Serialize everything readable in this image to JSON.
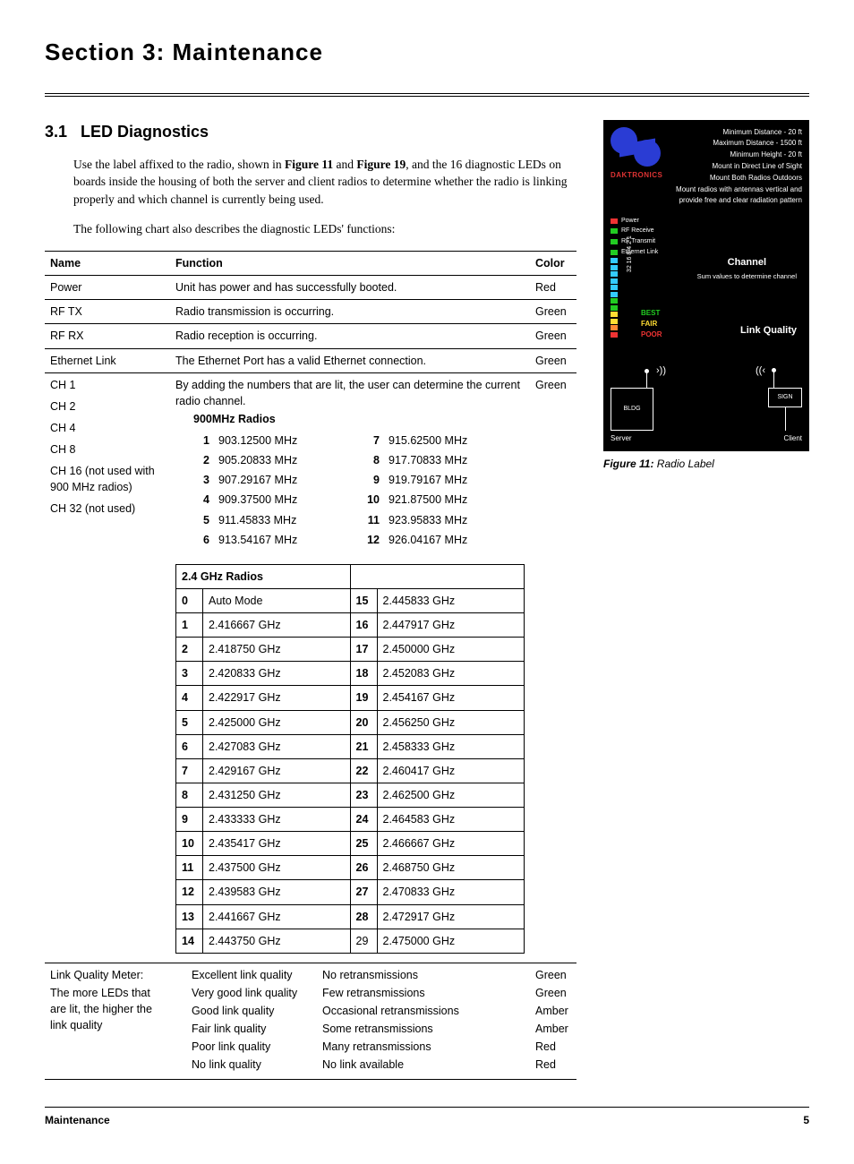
{
  "section_title": "Section 3:   Maintenance",
  "sub_num": "3.1",
  "sub_title": "LED Diagnostics",
  "para1_a": "Use the label affixed to the radio, shown in ",
  "para1_fig11": "Figure 11",
  "para1_b": " and ",
  "para1_fig19": "Figure 19",
  "para1_c": ", and the 16 diagnostic LEDs on boards inside the housing of both the server and client radios to determine whether the radio is linking properly and which channel is currently being used.",
  "para2": "The following chart also describes the diagnostic LEDs' functions:",
  "th_name": "Name",
  "th_function": "Function",
  "th_color": "Color",
  "rows_simple": [
    {
      "name": "Power",
      "fn": "Unit has power and has successfully booted.",
      "color": "Red"
    },
    {
      "name": "RF TX",
      "fn": "Radio transmission is occurring.",
      "color": "Green"
    },
    {
      "name": "RF RX",
      "fn": "Radio reception is occurring.",
      "color": "Green"
    },
    {
      "name": "Ethernet Link",
      "fn": "The Ethernet Port has a valid Ethernet connection.",
      "color": "Green"
    }
  ],
  "ch_names": [
    "CH 1",
    "CH 2",
    "CH 4",
    "CH 8",
    "CH 16 (not used with 900 MHz radios)",
    "CH 32 (not used)"
  ],
  "ch_fn_intro": "By adding the numbers that are lit, the user can determine the current radio channel.",
  "ch_color": "Green",
  "head_900": "900MHz Radios",
  "freq_900_a": [
    {
      "n": "1",
      "v": "903.12500 MHz"
    },
    {
      "n": "2",
      "v": "905.20833 MHz"
    },
    {
      "n": "3",
      "v": "907.29167 MHz"
    },
    {
      "n": "4",
      "v": "909.37500 MHz"
    },
    {
      "n": "5",
      "v": "911.45833 MHz"
    },
    {
      "n": "6",
      "v": "913.54167 MHz"
    }
  ],
  "freq_900_b": [
    {
      "n": "7",
      "v": "915.62500 MHz"
    },
    {
      "n": "8",
      "v": "917.70833 MHz"
    },
    {
      "n": "9",
      "v": "919.79167 MHz"
    },
    {
      "n": "10",
      "v": "921.87500 MHz"
    },
    {
      "n": "11",
      "v": "923.95833 MHz"
    },
    {
      "n": "12",
      "v": "926.04167 MHz"
    }
  ],
  "head_24": "2.4 GHz Radios",
  "freq_24": [
    {
      "n": "0",
      "v": "Auto Mode",
      "n2": "15",
      "v2": "2.445833 GHz"
    },
    {
      "n": "1",
      "v": "2.416667 GHz",
      "n2": "16",
      "v2": "2.447917 GHz"
    },
    {
      "n": "2",
      "v": "2.418750 GHz",
      "n2": "17",
      "v2": "2.450000 GHz"
    },
    {
      "n": "3",
      "v": "2.420833 GHz",
      "n2": "18",
      "v2": "2.452083 GHz"
    },
    {
      "n": "4",
      "v": "2.422917 GHz",
      "n2": "19",
      "v2": "2.454167 GHz"
    },
    {
      "n": "5",
      "v": "2.425000 GHz",
      "n2": "20",
      "v2": "2.456250 GHz"
    },
    {
      "n": "6",
      "v": "2.427083 GHz",
      "n2": "21",
      "v2": "2.458333 GHz"
    },
    {
      "n": "7",
      "v": "2.429167 GHz",
      "n2": "22",
      "v2": "2.460417 GHz"
    },
    {
      "n": "8",
      "v": "2.431250 GHz",
      "n2": "23",
      "v2": "2.462500 GHz"
    },
    {
      "n": "9",
      "v": "2.433333 GHz",
      "n2": "24",
      "v2": "2.464583 GHz"
    },
    {
      "n": "10",
      "v": "2.435417 GHz",
      "n2": "25",
      "v2": "2.466667 GHz"
    },
    {
      "n": "11",
      "v": "2.437500 GHz",
      "n2": "26",
      "v2": "2.468750 GHz"
    },
    {
      "n": "12",
      "v": "2.439583 GHz",
      "n2": "27",
      "v2": "2.470833 GHz"
    },
    {
      "n": "13",
      "v": "2.441667 GHz",
      "n2": "28",
      "v2": "2.472917 GHz"
    },
    {
      "n": "14",
      "v": "2.443750 GHz",
      "n2": "29",
      "v2": "2.475000 GHz",
      "n2plain": true
    }
  ],
  "lqm_name1": "Link Quality Meter:",
  "lqm_name2": "The more LEDs that are lit, the higher the link quality",
  "lqm_levels": [
    {
      "q": "Excellent link quality",
      "r": "No retransmissions",
      "c": "Green"
    },
    {
      "q": "Very good link quality",
      "r": "Few retransmissions",
      "c": "Green"
    },
    {
      "q": "Good link quality",
      "r": "Occasional retransmissions",
      "c": "Amber"
    },
    {
      "q": "Fair link quality",
      "r": "Some retransmissions",
      "c": "Amber"
    },
    {
      "q": "Poor link quality",
      "r": "Many retransmissions",
      "c": "Red"
    },
    {
      "q": "No link quality",
      "r": "No link available",
      "c": "Red"
    }
  ],
  "footer_left": "Maintenance",
  "footer_right": "5",
  "fig_caption_b": "Figure 11:",
  "fig_caption_i": " Radio Label",
  "label": {
    "specs": [
      "Minimum Distance - 20 ft",
      "Maximum Distance - 1500 ft",
      "Minimum Height - 20 ft",
      "Mount in Direct Line of Sight",
      "Mount Both Radios Outdoors",
      "Mount radios with antennas vertical and",
      "provide free and clear radiation pattern"
    ],
    "brand": "DAKTRONICS",
    "leds": [
      {
        "t": "Power",
        "c": "red"
      },
      {
        "t": "RF Receive",
        "c": "grn"
      },
      {
        "t": "RF Transmit",
        "c": "grn"
      },
      {
        "t": "Ethernet Link",
        "c": "grn"
      },
      {
        "t": "",
        "c": "cyn"
      },
      {
        "t": "",
        "c": "cyn"
      },
      {
        "t": "",
        "c": "cyn"
      },
      {
        "t": "",
        "c": "cyn"
      },
      {
        "t": "",
        "c": "cyn"
      },
      {
        "t": "",
        "c": "cyn"
      },
      {
        "t": "",
        "c": "grn"
      },
      {
        "t": "",
        "c": "grn"
      },
      {
        "t": "",
        "c": "yel"
      },
      {
        "t": "",
        "c": "yel"
      },
      {
        "t": "",
        "c": "org"
      },
      {
        "t": "",
        "c": "red"
      }
    ],
    "nums": "32 16 8  4  2  1",
    "channel_hd": "Channel",
    "channel_sub": "Sum values to determine channel",
    "lq": "Link Quality",
    "bfp": {
      "best": "BEST",
      "fair": "FAIR",
      "poor": "POOR"
    },
    "bldg": "BLDG",
    "sign": "SIGN",
    "server": "Server",
    "client": "Client"
  }
}
